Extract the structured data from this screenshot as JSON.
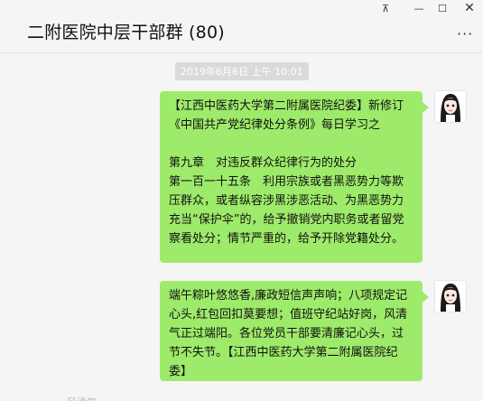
{
  "window": {
    "title": "二附医院中层干部群 (80)",
    "controls": {
      "pin": "⊼",
      "minimize": "—",
      "maximize": "☐",
      "close": "✕"
    },
    "more": "···"
  },
  "chat": {
    "timestamp": "2019年6月6日 上午 10:01",
    "messages": [
      {
        "text": "【江西中医药大学第二附属医院纪委】新修订《中国共产党纪律处分条例》每日学习之\n\n第九章　对违反群众纪律行为的处分\n第一百一十五条　利用宗族或者黑恶势力等欺压群众，或者纵容涉黑涉恶活动、为黑恶势力充当“保护伞”的，给予撤销党内职务或者留党察看处分；情节严重的，给予开除党籍处分。",
        "avatar": "avatar-icon"
      },
      {
        "text": "端午粽叶悠悠香,廉政短信声声响；八项规定记心头,红包回扣莫要想；值班守纪站好岗，风清气正过端阳。各位党员干部要清廉记心头，过节不失节。【江西中医药大学第二附属医院纪委】",
        "avatar": "avatar-icon"
      }
    ],
    "cutoff_text": "风清气"
  },
  "colors": {
    "bubble": "#9eea6a",
    "background": "#f5f5f5",
    "timestamp_bg": "#dadada"
  }
}
